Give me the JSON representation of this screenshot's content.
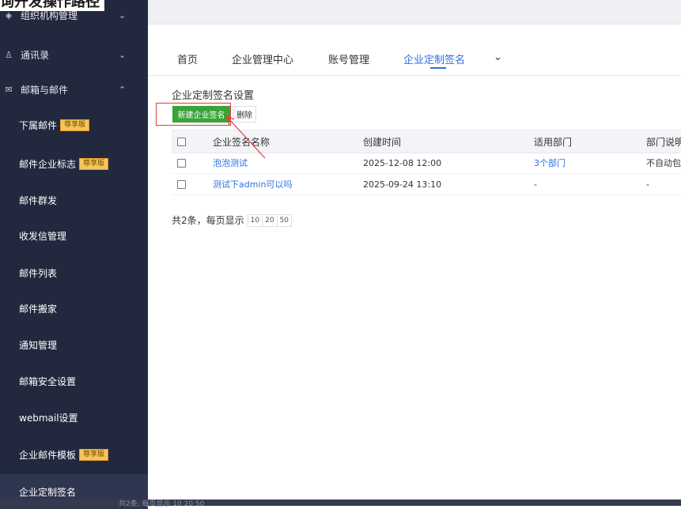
{
  "doc_title": "询开发操作路径",
  "sidebar": {
    "groups": [
      {
        "label": "组织机构管理",
        "icon": "layers-icon",
        "chevron": "chevron-down"
      },
      {
        "label": "通讯录",
        "icon": "user-icon",
        "chevron": "chevron-down"
      },
      {
        "label": "邮箱与邮件",
        "icon": "mail-icon",
        "chevron": "chevron-up"
      }
    ],
    "items": [
      {
        "label": "下属邮件",
        "badge": "尊享版"
      },
      {
        "label": "邮件企业标志",
        "badge": "尊享版"
      },
      {
        "label": "邮件群发"
      },
      {
        "label": "收发信管理"
      },
      {
        "label": "邮件列表"
      },
      {
        "label": "邮件搬家"
      },
      {
        "label": "通知管理"
      },
      {
        "label": "邮箱安全设置"
      },
      {
        "label": "webmail设置"
      },
      {
        "label": "企业邮件模板",
        "badge": "尊享版"
      },
      {
        "label": "企业定制签名",
        "active": true
      }
    ]
  },
  "bottom_strip": "共2条, 每页显示 10 20 50",
  "tabs": [
    {
      "label": "首页"
    },
    {
      "label": "企业管理中心"
    },
    {
      "label": "账号管理"
    },
    {
      "label": "企业定制签名",
      "active": true
    }
  ],
  "tabs_more": "⌄",
  "main": {
    "section_title": "企业定制签名设置",
    "new_button": "新建企业签名",
    "delete_button": "删除",
    "columns": [
      "企业签名名称",
      "创建时间",
      "适用部门",
      "部门说明"
    ],
    "rows": [
      {
        "name": "泡泡测试",
        "created": "2025-12-08 12:00",
        "dept": "3个部门",
        "desc": "不自动包含"
      },
      {
        "name": "测试下admin可以吗",
        "created": "2025-09-24 13:10",
        "dept": "-",
        "desc": "-"
      }
    ],
    "pager_text": "共2条，每页显示",
    "page_sizes": [
      "10",
      "20",
      "50"
    ]
  },
  "colors": {
    "sidebar": "#22283d",
    "accent": "#2f6fe4",
    "primary_button": "#3aa339",
    "highlight": "#e53935"
  }
}
